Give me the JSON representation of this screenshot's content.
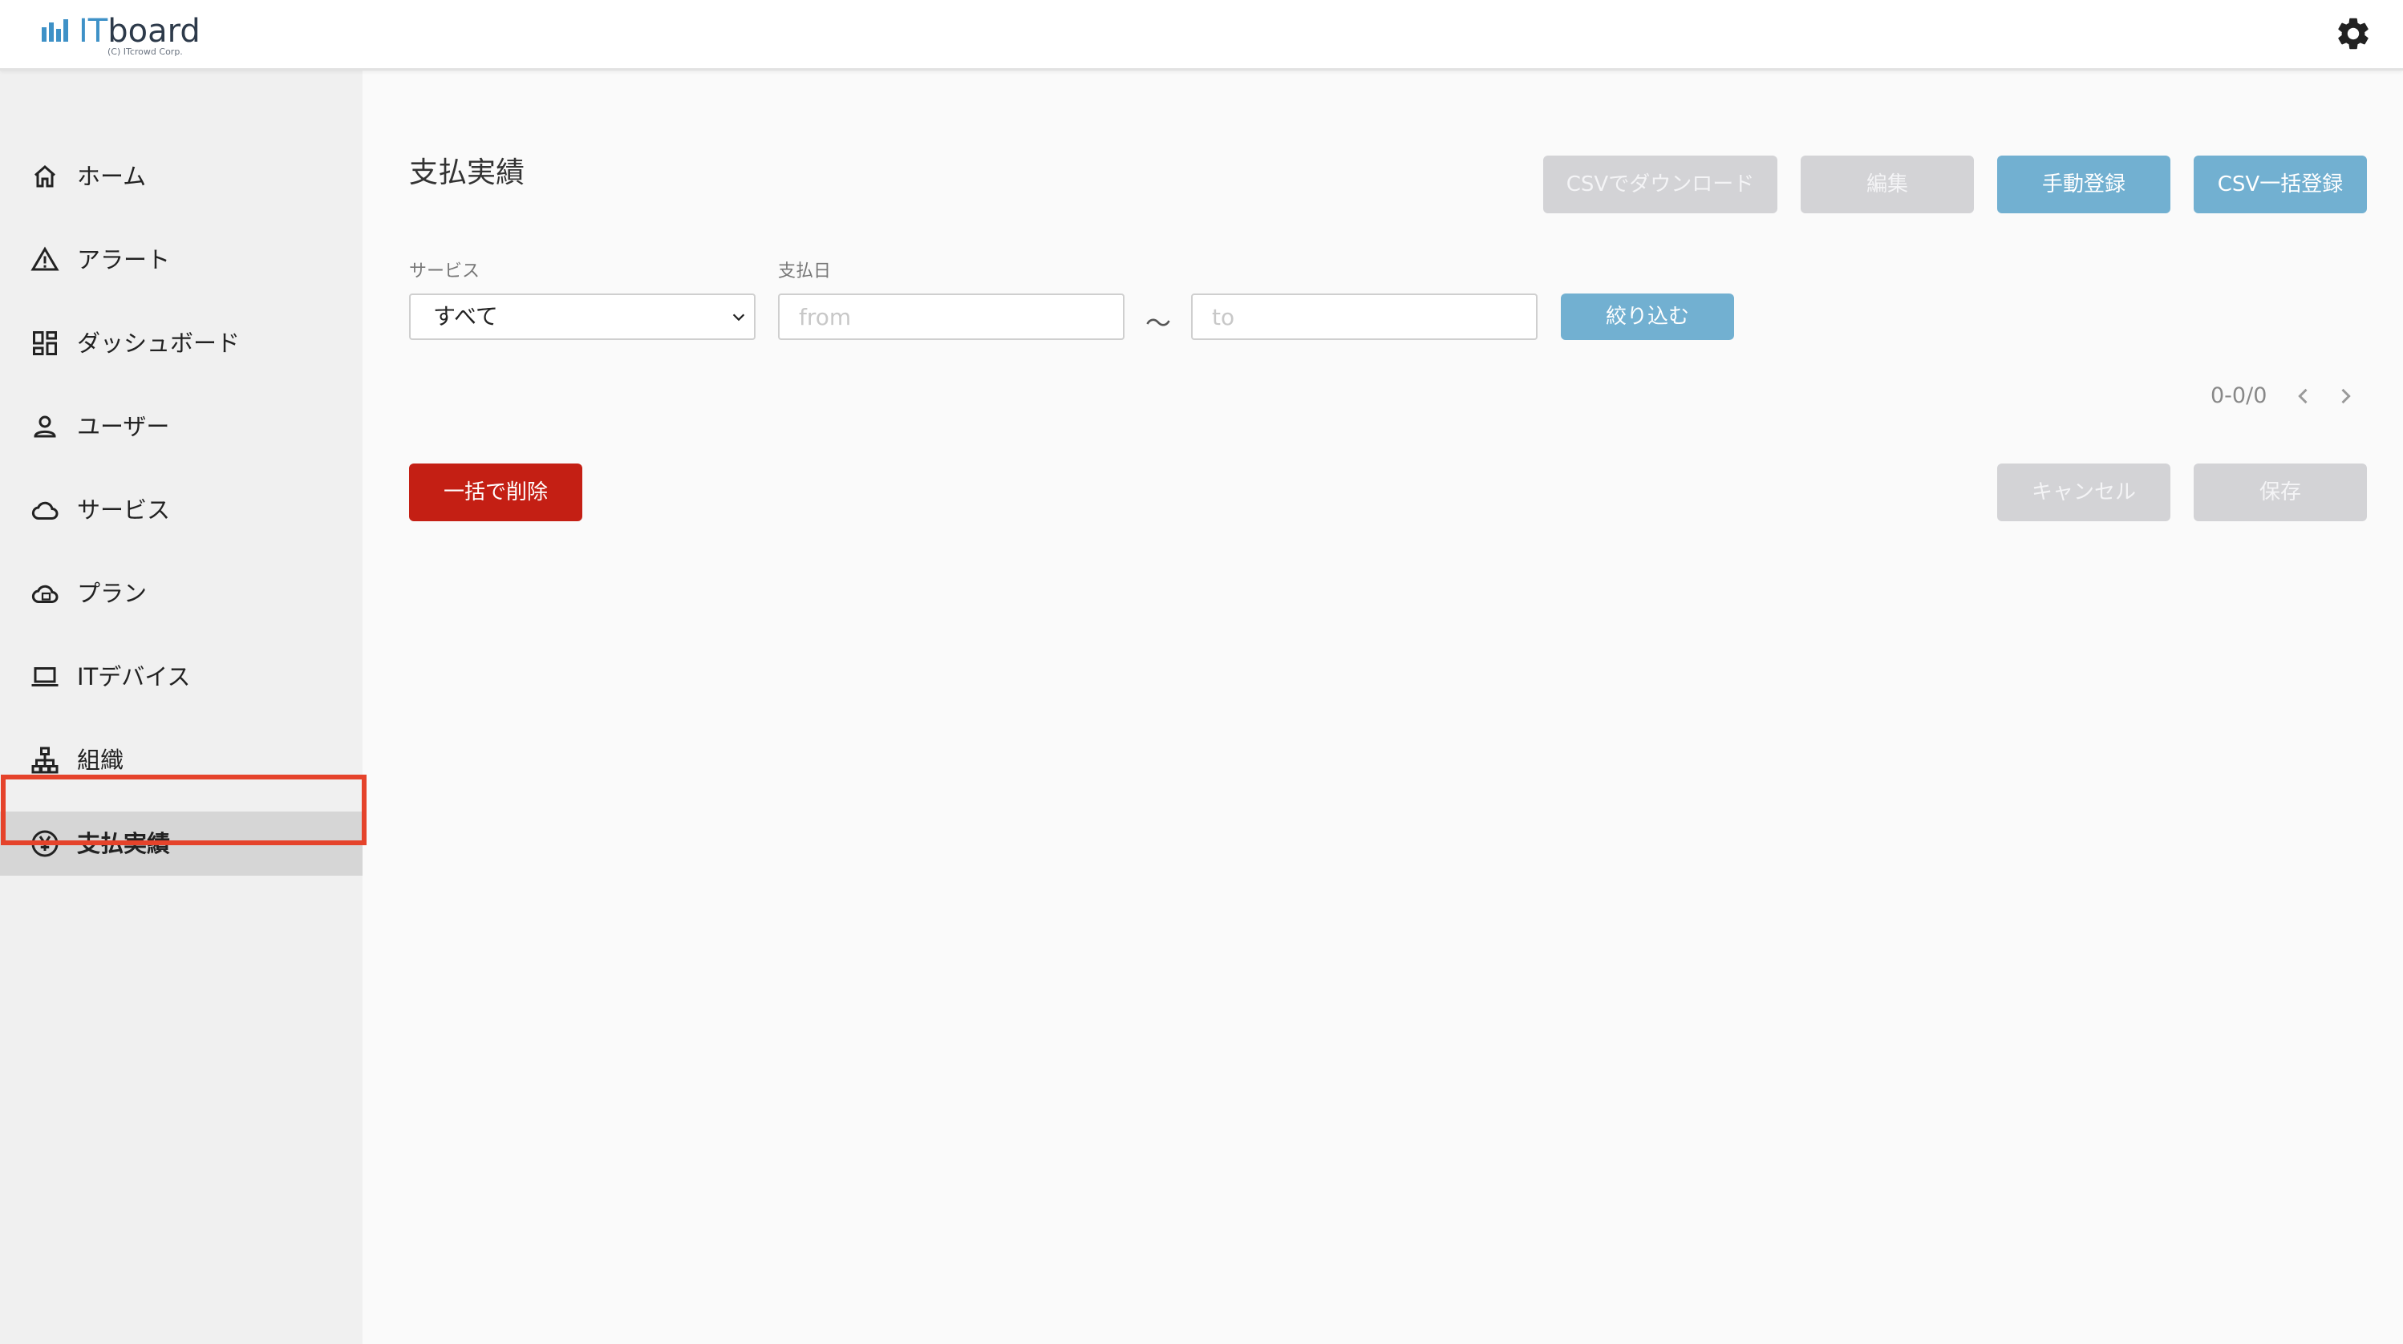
{
  "header": {
    "logo_prefix": "IT",
    "logo_suffix": "board",
    "logo_sub": "(C)  ITcrowd Corp."
  },
  "sidebar": {
    "items": [
      {
        "label": "ホーム",
        "icon": "home-icon"
      },
      {
        "label": "アラート",
        "icon": "alert-icon"
      },
      {
        "label": "ダッシュボード",
        "icon": "dashboard-icon"
      },
      {
        "label": "ユーザー",
        "icon": "user-icon"
      },
      {
        "label": "サービス",
        "icon": "cloud-icon"
      },
      {
        "label": "プラン",
        "icon": "plan-icon"
      },
      {
        "label": "ITデバイス",
        "icon": "laptop-icon"
      },
      {
        "label": "組織",
        "icon": "org-icon"
      },
      {
        "label": "支払実績",
        "icon": "yen-icon",
        "active": true
      }
    ]
  },
  "main": {
    "title": "支払実績",
    "toolbar": {
      "csv_download": "CSVでダウンロード",
      "edit": "編集",
      "manual_register": "手動登録",
      "csv_bulk_register": "CSV一括登録"
    },
    "filters": {
      "service_label": "サービス",
      "service_value": "すべて",
      "date_label": "支払日",
      "from_placeholder": "from",
      "to_placeholder": "to",
      "range_separator": "～",
      "apply": "絞り込む"
    },
    "pagination": {
      "text": "0-0/0"
    },
    "actions": {
      "bulk_delete": "一括で削除",
      "cancel": "キャンセル",
      "save": "保存"
    }
  },
  "colors": {
    "primary": "#72b0d1",
    "danger": "#c41f14",
    "disabled": "#d3d3d6",
    "highlight": "#e5432b",
    "brand_blue": "#3e91c7"
  }
}
